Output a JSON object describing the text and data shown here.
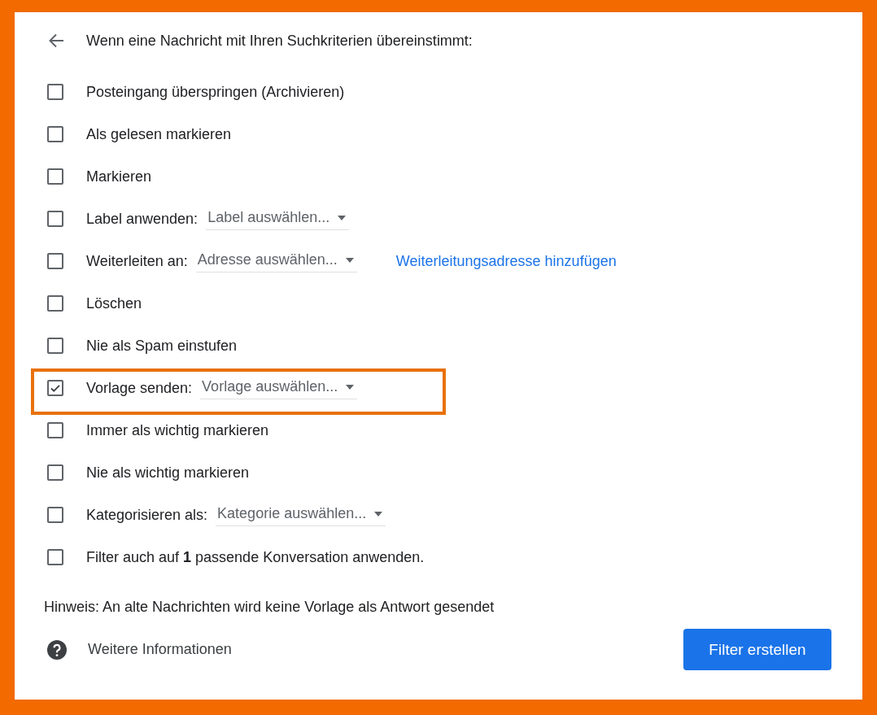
{
  "header": {
    "title": "Wenn eine Nachricht mit Ihren Suchkriterien übereinstimmt:"
  },
  "options": [
    {
      "kind": "plain",
      "label": "Posteingang überspringen (Archivieren)",
      "checked": false,
      "highlighted": false
    },
    {
      "kind": "plain",
      "label": "Als gelesen markieren",
      "checked": false,
      "highlighted": false
    },
    {
      "kind": "plain",
      "label": "Markieren",
      "checked": false,
      "highlighted": false
    },
    {
      "kind": "select",
      "label": "Label anwenden:",
      "select": "Label auswählen...",
      "checked": false,
      "highlighted": false
    },
    {
      "kind": "select",
      "label": "Weiterleiten an:",
      "select": "Adresse auswählen...",
      "link": "Weiterleitungsadresse hinzufügen",
      "checked": false,
      "highlighted": false
    },
    {
      "kind": "plain",
      "label": "Löschen",
      "checked": false,
      "highlighted": false
    },
    {
      "kind": "plain",
      "label": "Nie als Spam einstufen",
      "checked": false,
      "highlighted": false
    },
    {
      "kind": "select",
      "label": "Vorlage senden:",
      "select": "Vorlage auswählen...",
      "checked": true,
      "highlighted": true
    },
    {
      "kind": "plain",
      "label": "Immer als wichtig markieren",
      "checked": false,
      "highlighted": false
    },
    {
      "kind": "plain",
      "label": "Nie als wichtig markieren",
      "checked": false,
      "highlighted": false
    },
    {
      "kind": "select",
      "label": "Kategorisieren als:",
      "select": "Kategorie auswählen...",
      "checked": false,
      "highlighted": false
    },
    {
      "kind": "rich",
      "label": "Filter auch auf **1** passende Konversation anwenden.",
      "checked": false,
      "highlighted": false
    }
  ],
  "hint": "Hinweis: An alte Nachrichten wird keine Vorlage als Antwort gesendet",
  "help_link": "Weitere Informationen",
  "buttons": [
    "Filter erstellen"
  ]
}
